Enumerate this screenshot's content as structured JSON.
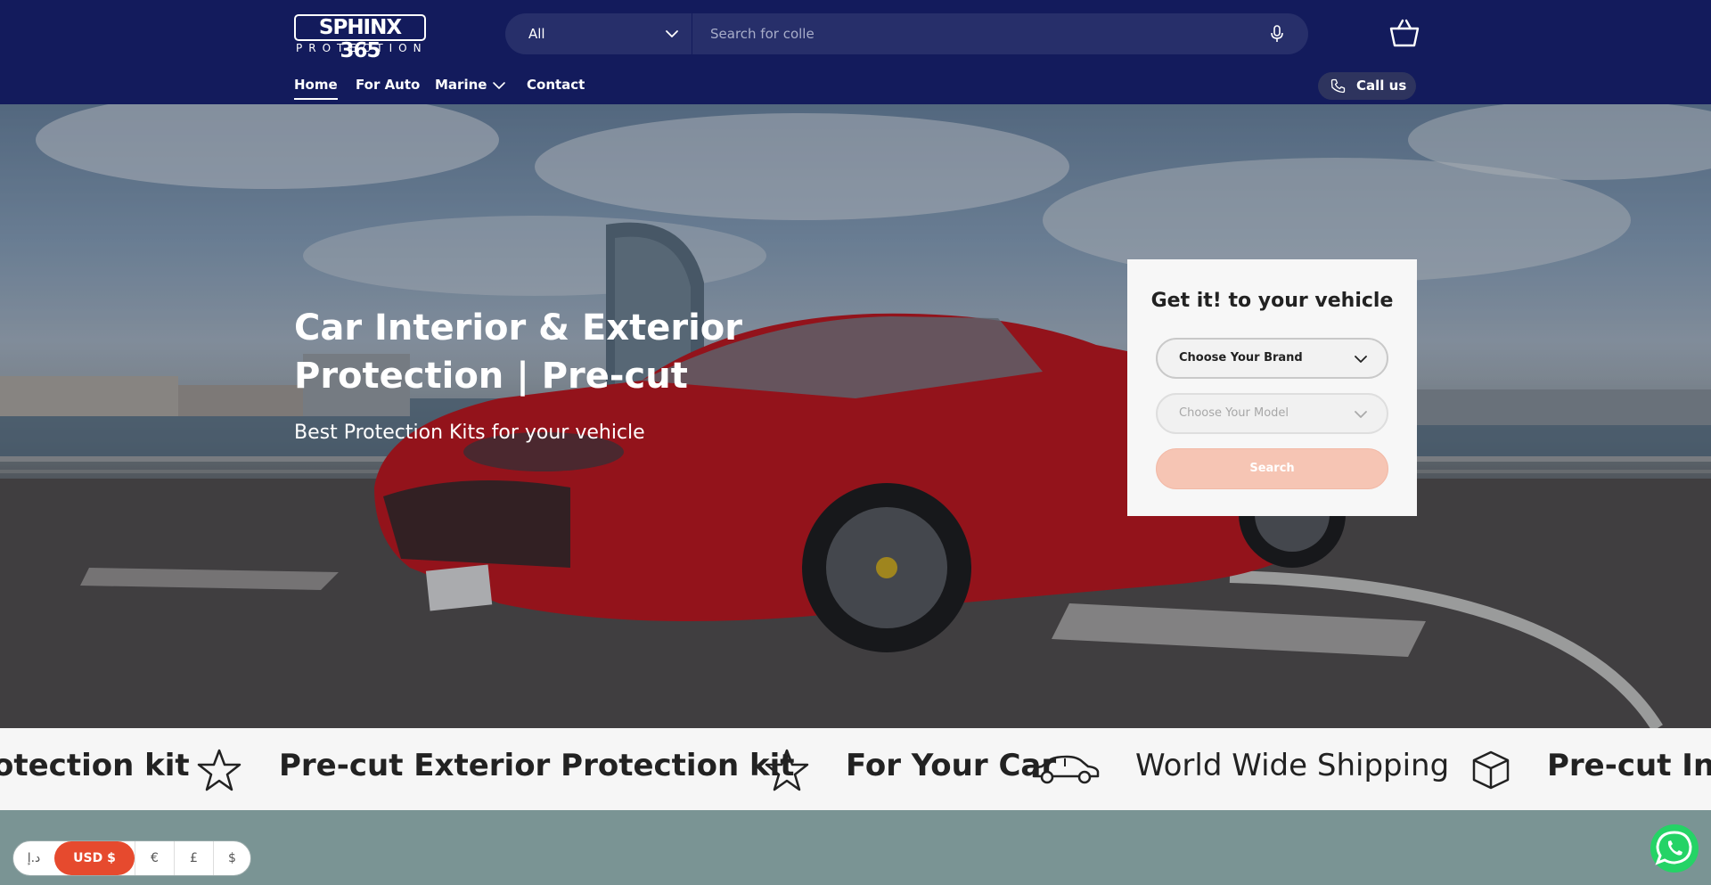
{
  "header": {
    "logo_main": "SPHINX 365",
    "logo_sub": "PROTECTION",
    "search": {
      "category": "All",
      "placeholder": "Search for colle"
    },
    "nav": [
      {
        "label": "Home"
      },
      {
        "label": "For Auto"
      },
      {
        "label": "Marine"
      },
      {
        "label": "Contact"
      }
    ],
    "call_label": "Call us"
  },
  "hero": {
    "title": "Car Interior & Exterior Protection | Pre-cut",
    "subtitle": "Best Protection Kits for your vehicle"
  },
  "vehicle_finder": {
    "title": "Get it! to your vehicle",
    "brand_label": "Choose Your Brand",
    "model_label": "Choose Your Model",
    "search_label": "Search"
  },
  "marquee": {
    "items": [
      "otection kit",
      "Pre-cut Exterior Protection kit",
      "For Your Car",
      "World Wide Shipping",
      "Pre-cut Int"
    ]
  },
  "currency": {
    "items": [
      "د.إ",
      "USD $",
      "€",
      "£",
      "$"
    ],
    "selected": "USD $"
  },
  "colors": {
    "header_bg": "#131b5c",
    "accent": "#e64a2e",
    "search_button_disabled": "#f6c5b4"
  }
}
